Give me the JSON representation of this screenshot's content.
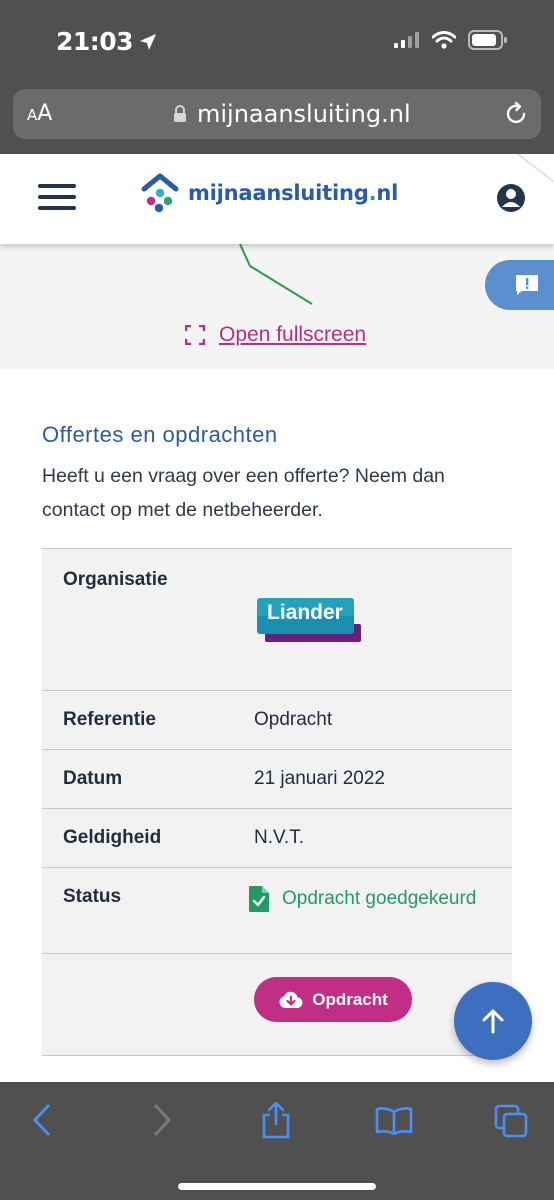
{
  "status_bar": {
    "time": "21:03"
  },
  "browser": {
    "text_size_label": "AA",
    "url": "mijnaansluiting.nl"
  },
  "site": {
    "logo_text": "mijnaansluiting",
    "logo_dot": ".",
    "logo_tld": "nl"
  },
  "map": {
    "fullscreen_label": "Open fullscreen"
  },
  "section": {
    "title": "Offertes en opdrachten",
    "intro": "Heeft u een vraag over een offerte? Neem dan contact op met de netbeheerder."
  },
  "details": {
    "organisatie_label": "Organisatie",
    "organisatie_logo_text": "Liander",
    "referentie_label": "Referentie",
    "referentie_value": "Opdracht",
    "datum_label": "Datum",
    "datum_value": "21 januari 2022",
    "geldigheid_label": "Geldigheid",
    "geldigheid_value": "N.V.T.",
    "status_label": "Status",
    "status_value": "Opdracht goedgekeurd",
    "download_button": "Opdracht"
  },
  "colors": {
    "brand_blue": "#2c5aa8",
    "accent_magenta": "#c02f84",
    "status_green": "#239a66"
  }
}
